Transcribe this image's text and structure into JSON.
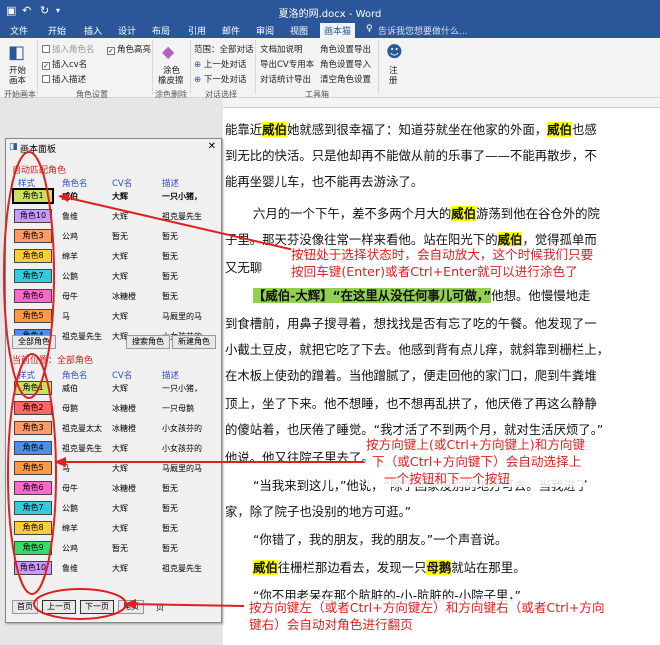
{
  "window": {
    "title": "夏洛的网.docx - Word"
  },
  "tabs": [
    "文件",
    "开始",
    "插入",
    "设计",
    "布局",
    "引用",
    "邮件",
    "审阅",
    "视图",
    "画本猫"
  ],
  "tell_me": "告诉我您想要做什么...",
  "ribbon": {
    "open_draw_line1": "开始",
    "open_draw_line2": "画本",
    "insert_role_name": "插入角色名",
    "insert_cv_name": "插入cv名",
    "insert_description": "插入描述",
    "role_highlight": "角色高亮",
    "erase_line1": "涂色",
    "erase_line2": "橡皮擦",
    "scope": "范围：全部对话",
    "prev_dialog": "上一处对话",
    "next_dialog": "下一处对话",
    "export_doc": "文档加说明",
    "export_cv": "导出CV专用本",
    "dialog_stats": "对话统计导出",
    "role_export": "角色设置导出",
    "role_import": "角色设置导入",
    "clear_roles": "清空角色设置",
    "logout_line1": "注",
    "logout_line2": "册",
    "group_start": "开始画本",
    "group_roles": "角色设置",
    "group_color": "涂色删除",
    "group_dialog": "对话选择",
    "group_toolset": "工具箱"
  },
  "doc": {
    "lines": [
      [
        [
          "能靠近",
          ""
        ],
        [
          "威伯",
          "hl"
        ],
        [
          "她就感到很幸福了：知道芬就坐在他家的外面，",
          ""
        ],
        [
          "威伯",
          "hl"
        ],
        [
          "也感",
          ""
        ]
      ],
      [
        [
          "到无比的快活。只是他却再不能做从前的乐事了——不能再散步，不",
          ""
        ]
      ],
      [
        [
          "能再坐婴儿车，也不能再去游泳了。",
          ""
        ]
      ],
      [
        [
          "六月的一个下午，差不多两个月大的",
          ""
        ],
        [
          "威伯",
          "hl"
        ],
        [
          "游荡到他在谷仓外的院",
          ""
        ]
      ],
      [
        [
          "子里。那天芬没像往常一样来看他。站在阳光下的",
          ""
        ],
        [
          "威伯",
          "hl"
        ],
        [
          "，觉得孤单而",
          ""
        ]
      ],
      [
        [
          "又无聊",
          ""
        ]
      ],
      [
        [
          "【威伯-大辉】“在这里从没任何事儿可做，”",
          "hlg"
        ],
        [
          "他想。他慢慢地走",
          ""
        ]
      ],
      [
        [
          "到食槽前，用鼻子搜寻着，想找找是否有忘了吃的午餐。他发现了一",
          ""
        ]
      ],
      [
        [
          "小截土豆皮，就把它吃了下去。他感到背有点儿痒，就斜靠到栅栏上，",
          ""
        ]
      ],
      [
        [
          "在木板上使劲的蹭着。当他蹭腻了，便走回他的家门口，爬到牛粪堆",
          ""
        ]
      ],
      [
        [
          "顶上，坐了下来。他不想睡，也不想再乱拱了，他厌倦了再这么静静",
          ""
        ]
      ],
      [
        [
          "的傻站着，也厌倦了睡觉。“我才活了不到两个月，就对生活厌烦了。”",
          ""
        ]
      ],
      [
        [
          "他说。他又往院子里去了。",
          ""
        ]
      ],
      [
        [
          "“当我来到这儿，”他说，“除了回家没别的地方可去。当我进了",
          ""
        ]
      ],
      [
        [
          "家，除了院子也没别的地方可逛。”",
          ""
        ]
      ],
      [
        [
          "“你错了，我的朋友，我的朋友。”一个声音说。",
          ""
        ]
      ],
      [
        [
          "威伯",
          "hl"
        ],
        [
          "往栅栏那边看去，发现一只",
          ""
        ],
        [
          "母鹅",
          "hl"
        ],
        [
          "就站在那里。",
          ""
        ]
      ],
      [
        [
          "“你不用老呆在那个肮脏的-小-肮脏的-小院子里，”",
          ""
        ]
      ]
    ]
  },
  "panel": {
    "title": "画本面板",
    "auto_match": "自动匹配角色",
    "headers": [
      "样式",
      "角色名",
      "CV名",
      "描述"
    ],
    "auto_rows": [
      [
        "角色1",
        "威伯",
        "大辉",
        "一只小猪，"
      ],
      [
        "角色10",
        "鲁维",
        "大辉",
        "祖克曼先生"
      ],
      [
        "角色3",
        "公鸡",
        "暂无",
        "暂无"
      ],
      [
        "角色8",
        "绵羊",
        "大辉",
        "暂无"
      ],
      [
        "角色7",
        "公鹅",
        "大辉",
        "暂无"
      ],
      [
        "角色6",
        "母牛",
        "冰糖橙",
        "暂无"
      ],
      [
        "角色5",
        "马",
        "大辉",
        "马厩里的马"
      ],
      [
        "角色4",
        "祖克曼先生",
        "大辉",
        "小女孩芬的"
      ]
    ],
    "all_roles_btn": "全部角色",
    "search_btn": "搜索角色",
    "new_btn": "新建角色",
    "current": "当前位置：全部角色",
    "all_rows": [
      [
        "角色1",
        "威伯",
        "大辉",
        "一只小猪，"
      ],
      [
        "角色2",
        "母鹅",
        "冰糖橙",
        "一只母鹅"
      ],
      [
        "角色3",
        "祖克曼太太",
        "冰糖橙",
        "小女孩芬的"
      ],
      [
        "角色4",
        "祖克曼先生",
        "大辉",
        "小女孩芬的"
      ],
      [
        "角色5",
        "马",
        "大辉",
        "马厩里的马"
      ],
      [
        "角色6",
        "母牛",
        "冰糖橙",
        "暂无"
      ],
      [
        "角色7",
        "公鹅",
        "大辉",
        "暂无"
      ],
      [
        "角色8",
        "绵羊",
        "大辉",
        "暂无"
      ],
      [
        "角色9",
        "公鸡",
        "暂无",
        "暂无"
      ],
      [
        "角色10",
        "鲁维",
        "大辉",
        "祖克曼先生"
      ]
    ],
    "first_btn": "首页",
    "prev_btn": "上一页",
    "next_btn": "下一页",
    "last_btn": "尾页",
    "page_info": "页"
  },
  "notes": {
    "n1_l1": "按钮处于选择状态时，会自动放大，这个时候我们只要",
    "n1_l2": "按回车键(Enter)或者Ctrl+Enter就可以进行涂色了",
    "n2_l1": "按方向键上(或Ctrl+方向键上)和方向键",
    "n2_l2": "下（或Ctrl+方向键下）会自动选择上",
    "n2_l3": "一个按钮和下一个按钮",
    "n3_l1": "按方向键左（或者Ctrl+方向键左）和方向键右（或者Ctrl+方向",
    "n3_l2": "键右）会自动对角色进行翻页"
  },
  "colors": {
    "word_blue": "#2b579a",
    "annotation_red": "#e02020",
    "highlight_yellow": "#ffff00",
    "highlight_green": "#92d050"
  },
  "role_colors": {
    "角色1": "#c8e060",
    "角色2": "#ff6666",
    "角色3": "#ff9966",
    "角色4": "#4d8fe6",
    "角色5": "#ff9944",
    "角色6": "#ff66cc",
    "角色7": "#33ccdd",
    "角色8": "#ffcc33",
    "角色9": "#33dd66",
    "角色10": "#cc99ff"
  }
}
